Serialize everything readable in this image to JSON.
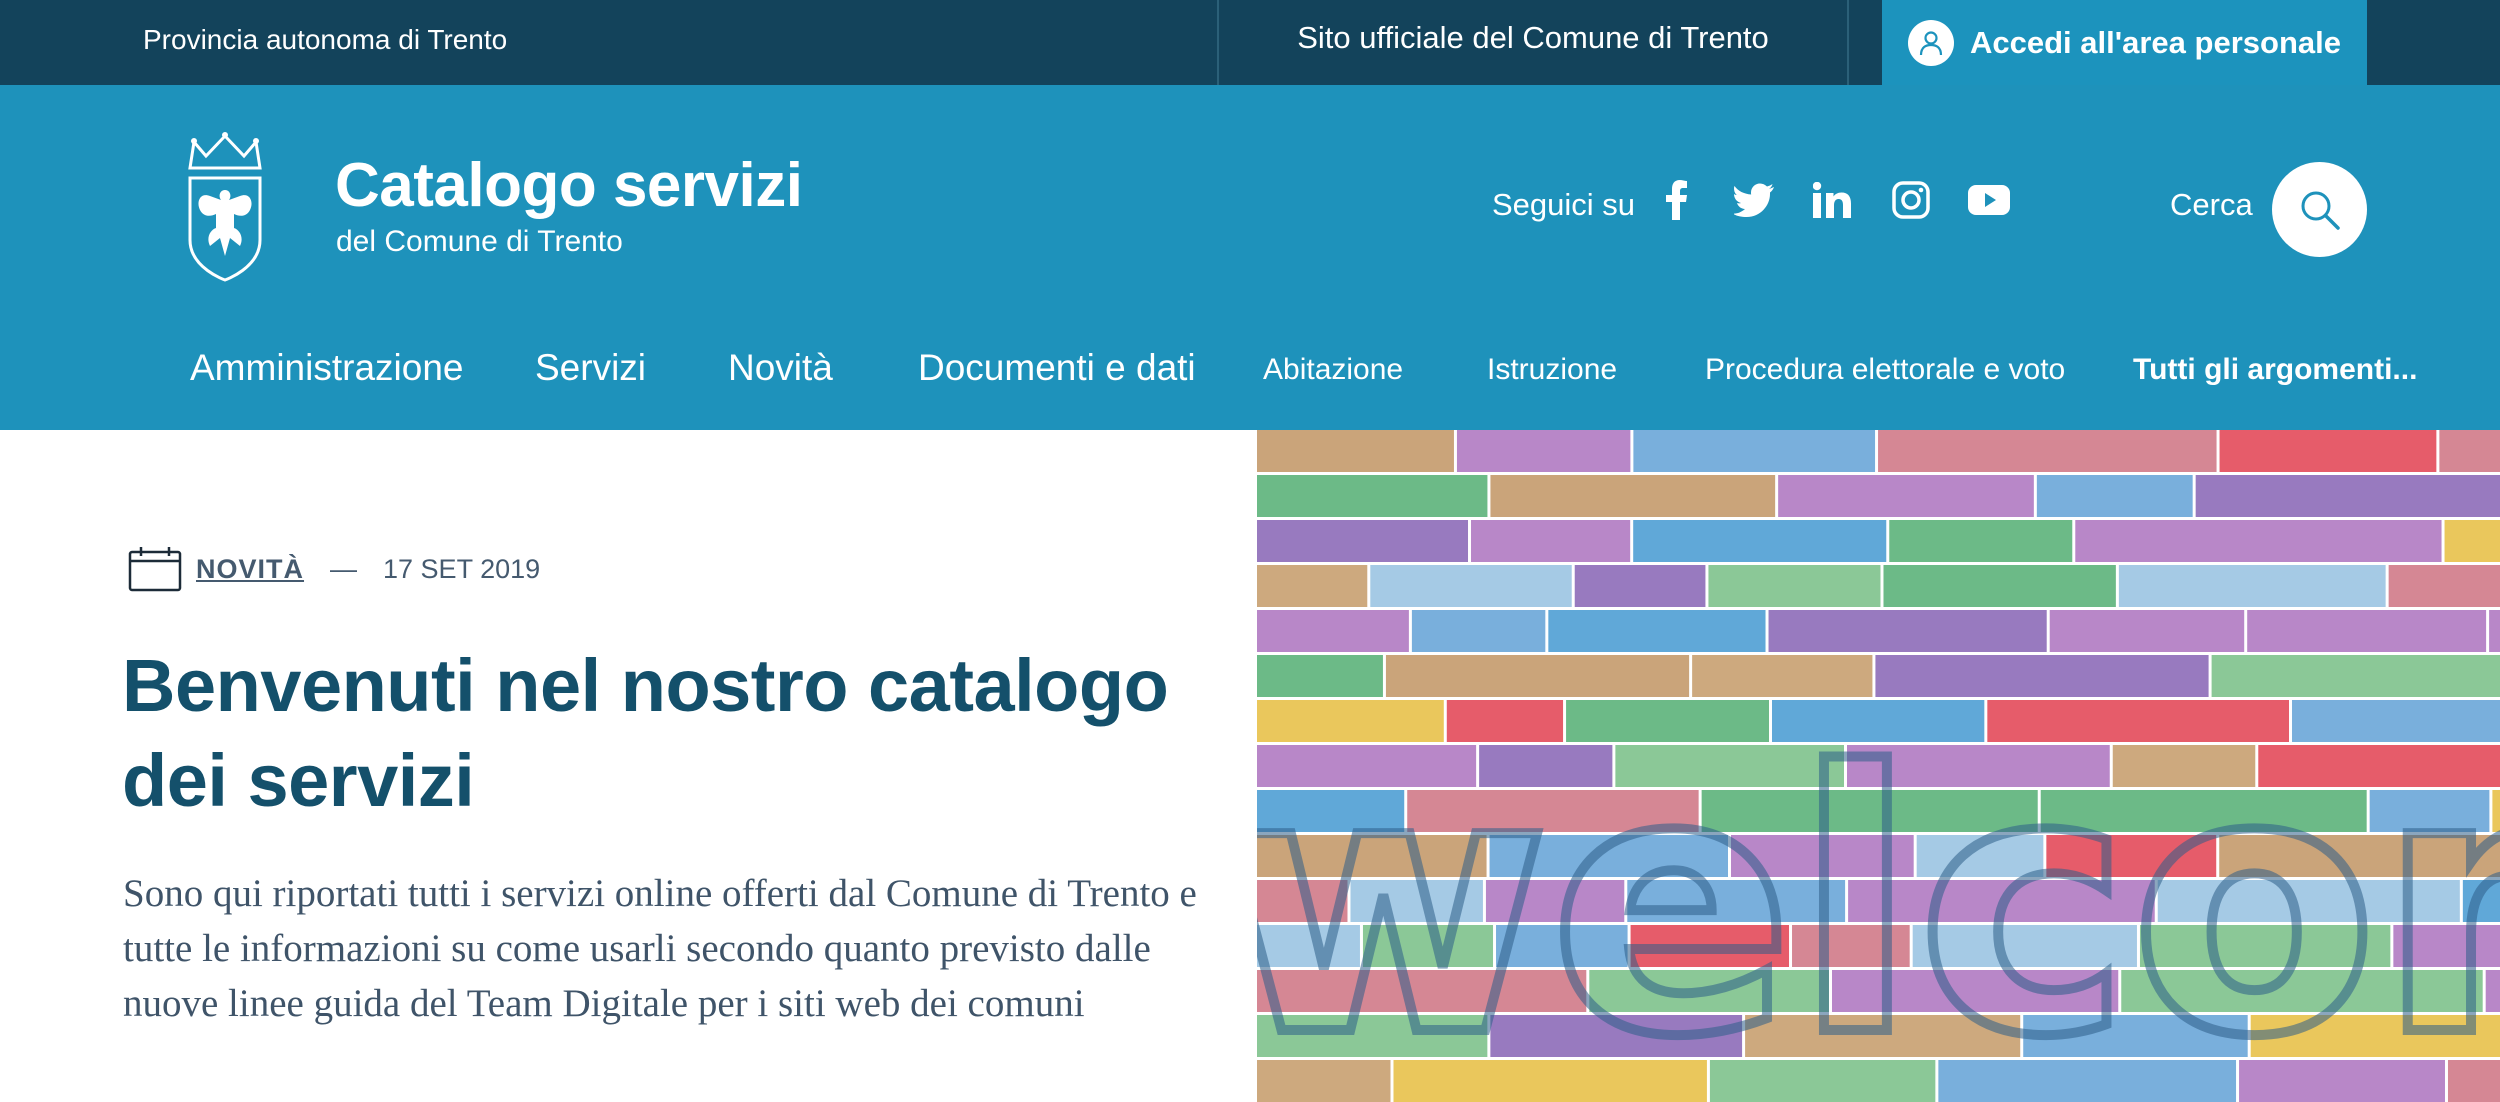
{
  "topbar": {
    "region": "Provincia autonoma di Trento",
    "official_site": "Sito ufficiale del Comune di Trento",
    "login_label": "Accedi all'area personale",
    "login_icon": "user-icon"
  },
  "header": {
    "title": "Catalogo servizi",
    "subtitle": "del Comune di Trento",
    "logo_icon": "crest-eagle-icon",
    "social_label": "Seguici su",
    "social_icons": [
      "facebook-icon",
      "twitter-icon",
      "linkedin-icon",
      "instagram-icon",
      "youtube-icon"
    ],
    "search_label": "Cerca",
    "search_icon": "search-icon"
  },
  "nav": {
    "main": [
      "Amministrazione",
      "Servizi",
      "Novità",
      "Documenti e dati"
    ],
    "topics": [
      "Abitazione",
      "Istruzione",
      "Procedura elettorale e voto"
    ],
    "all_topics": "Tutti gli argomenti..."
  },
  "hero": {
    "category": "NOVITÀ",
    "separator": "—",
    "date": "17 SET 2019",
    "title": "Benvenuti nel nostro catalogo dei servizi",
    "description": "Sono qui riportati tutti i servizi online offerti dal Comune di Trento e tutte le informazioni su come usarli secondo quanto previsto dalle nuove linee guida del Team Digitale per i siti web dei comuni",
    "image_text": "welcome"
  },
  "colors": {
    "topbar_bg": "#13435b",
    "header_bg": "#1e92bb",
    "login_bg": "#1c93bd",
    "title_color": "#14506b",
    "text_color": "#3f5469"
  }
}
